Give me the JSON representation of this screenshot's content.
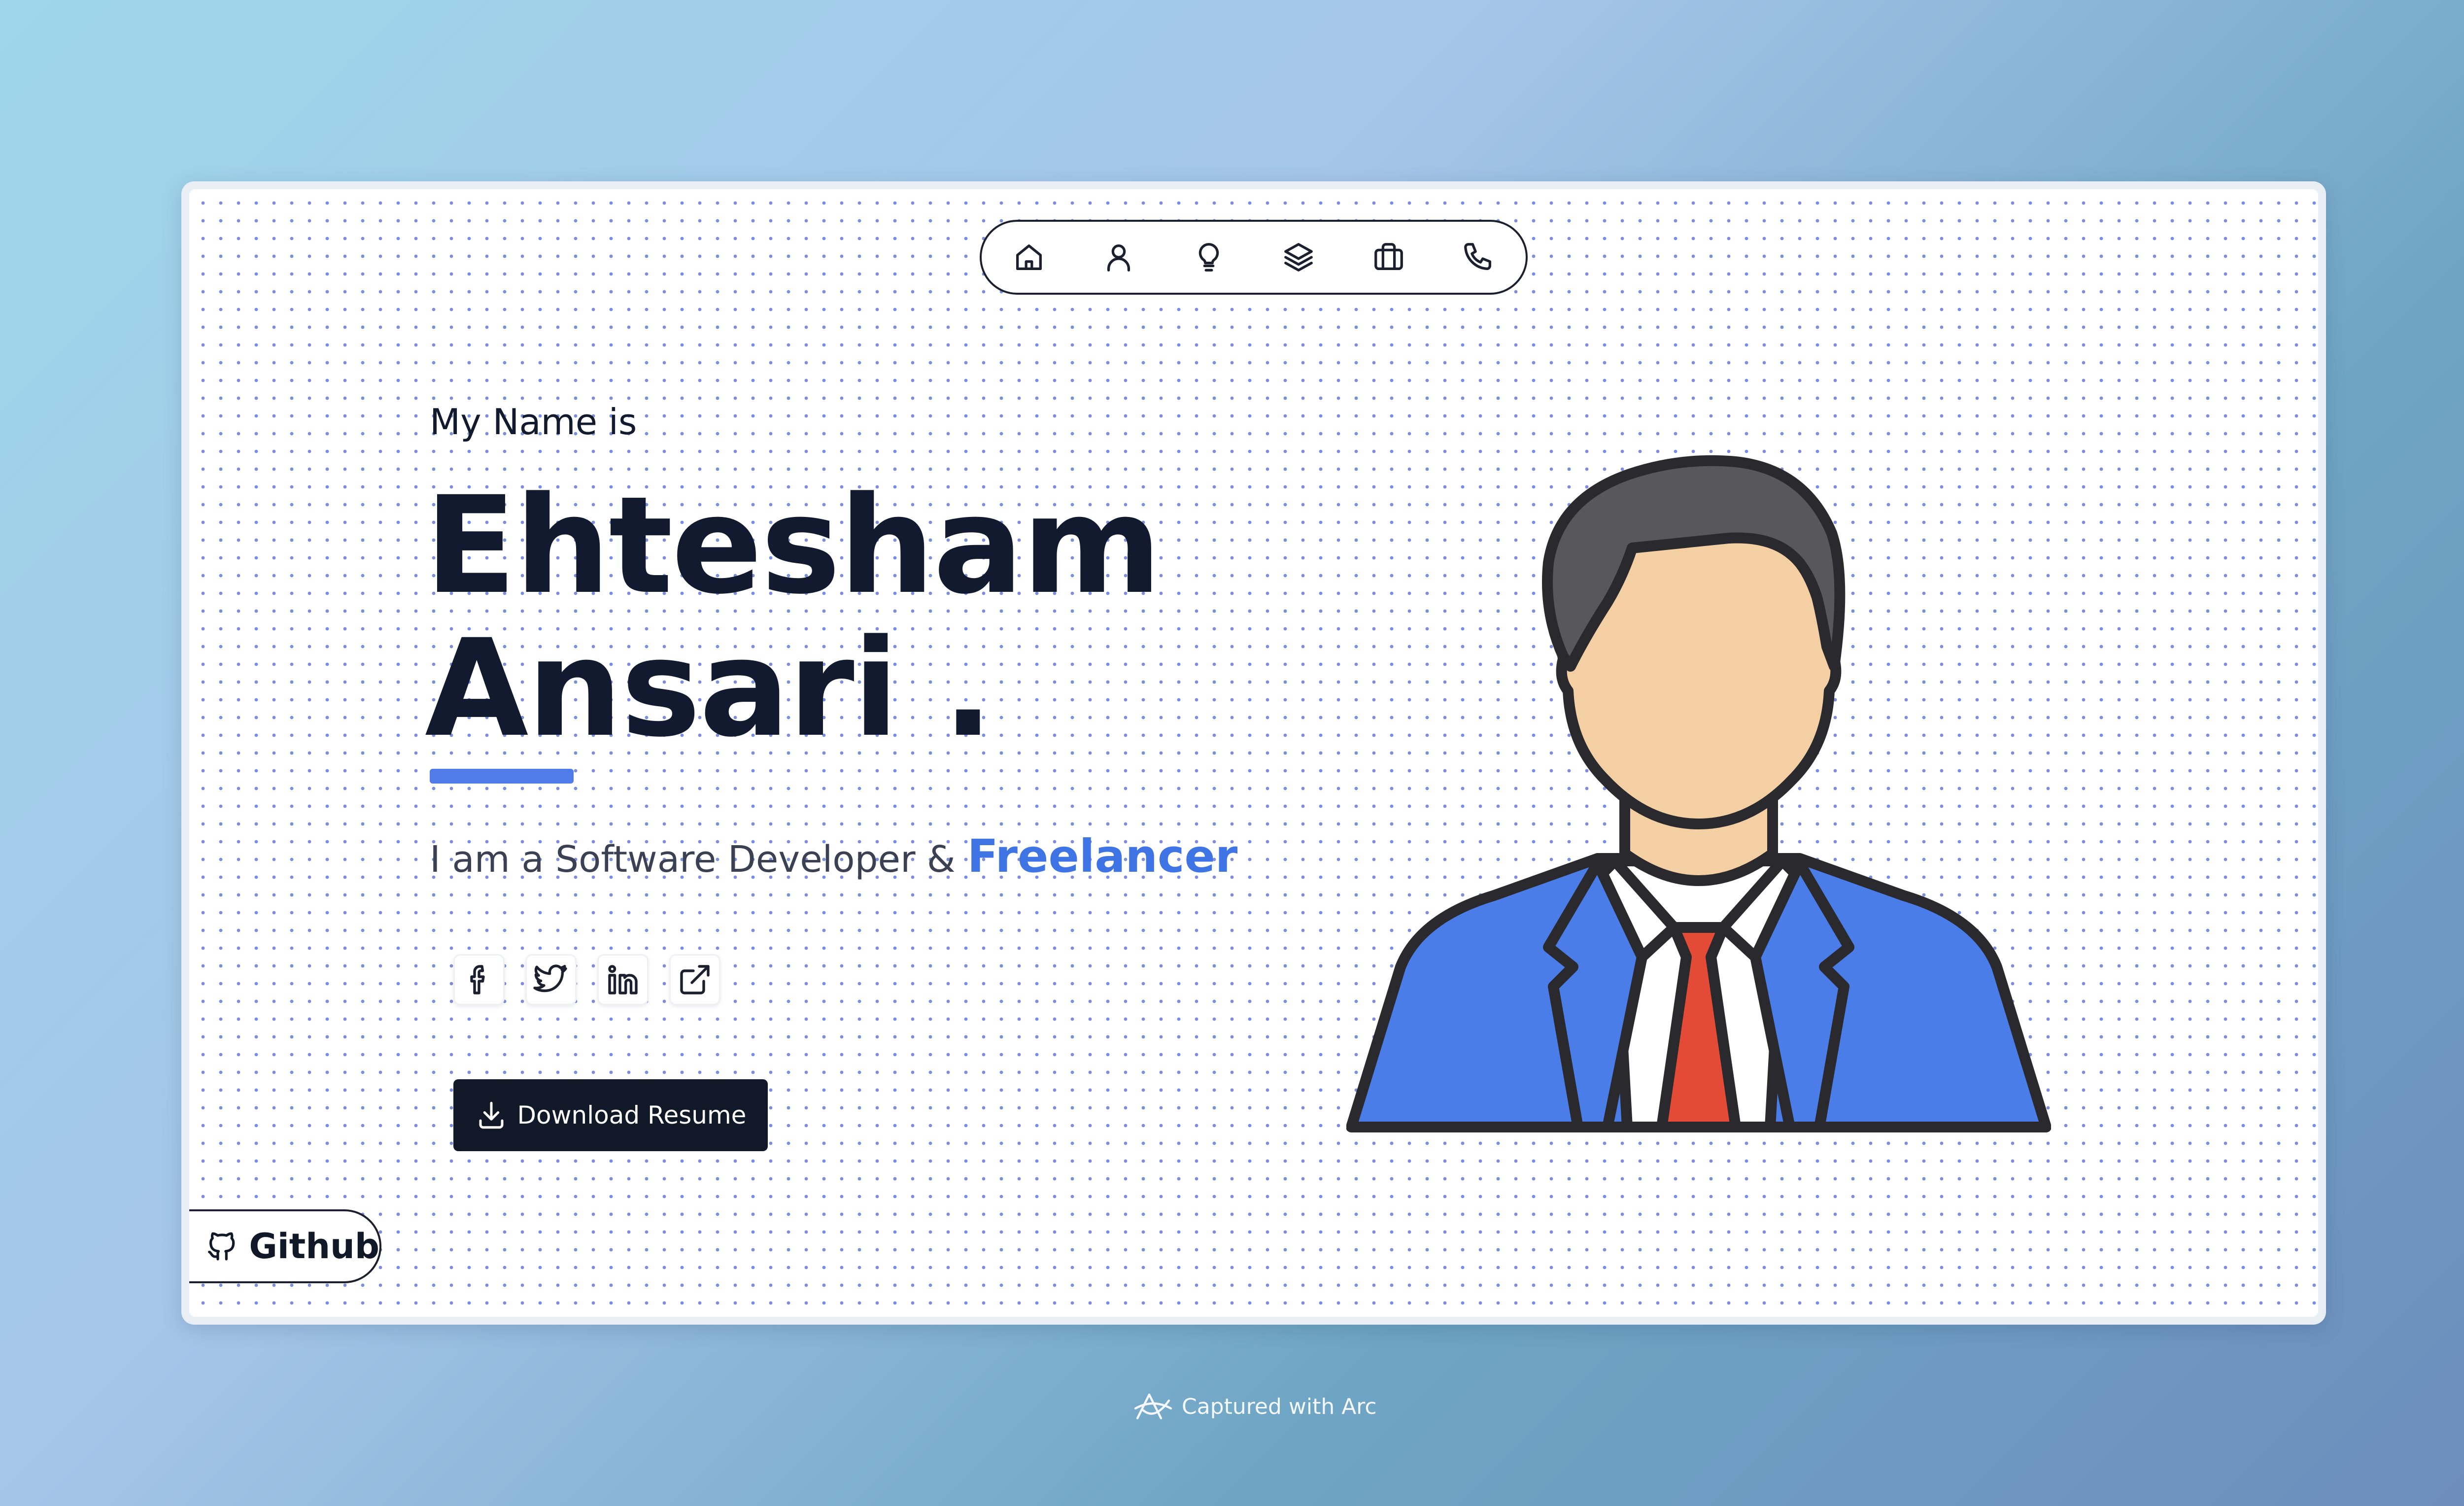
{
  "nav": {
    "items": [
      {
        "label": "Home",
        "icon": "home-icon"
      },
      {
        "label": "About",
        "icon": "user-icon"
      },
      {
        "label": "Skills",
        "icon": "lightbulb-icon"
      },
      {
        "label": "Projects",
        "icon": "layers-icon"
      },
      {
        "label": "Work",
        "icon": "briefcase-icon"
      },
      {
        "label": "Contact",
        "icon": "phone-icon"
      }
    ]
  },
  "hero": {
    "intro": "My Name is",
    "first_name": "Ehtesham",
    "last_name": "Ansari .",
    "tagline_prefix": "I am a Software Developer &",
    "tagline_highlight": "Freelancer",
    "accent_color": "#4f7ce9"
  },
  "socials": [
    {
      "name": "facebook",
      "icon": "facebook-icon"
    },
    {
      "name": "twitter",
      "icon": "twitter-icon"
    },
    {
      "name": "linkedin",
      "icon": "linkedin-icon"
    },
    {
      "name": "external-link",
      "icon": "external-link-icon"
    }
  ],
  "download_button": {
    "label": "Download Resume",
    "icon": "download-icon"
  },
  "github_tab": {
    "label": "Github",
    "icon": "github-icon"
  },
  "footer": {
    "label": "Captured with Arc",
    "icon": "arc-logo-icon"
  }
}
